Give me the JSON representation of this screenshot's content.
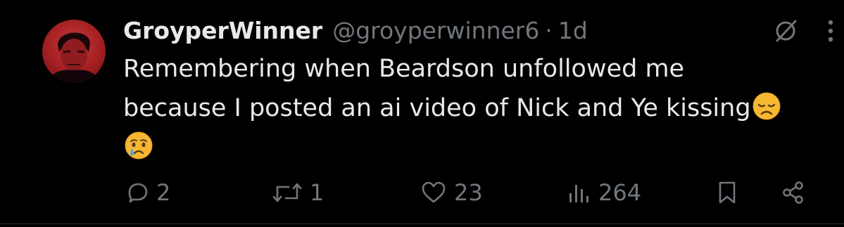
{
  "tweet": {
    "display_name": "GroyperWinner",
    "handle": "@groyperwinner6",
    "separator": "·",
    "time": "1d",
    "text_line1": "Remembering when Beardson unfollowed me",
    "text_line2": "because I posted an ai video of Nick and Ye kissing",
    "emojis": [
      "disappointed-face",
      "crying-face"
    ]
  },
  "actions": {
    "reply_count": "2",
    "retweet_count": "1",
    "like_count": "23",
    "views_count": "264"
  },
  "icons": {
    "reply": "reply-icon",
    "retweet": "retweet-icon",
    "like": "heart-icon",
    "views": "views-icon",
    "bookmark": "bookmark-icon",
    "share": "share-icon",
    "grok": "grok-icon",
    "more": "more-icon"
  },
  "colors": {
    "background": "#000000",
    "text": "#e7e9ea",
    "secondary": "#71767b"
  }
}
